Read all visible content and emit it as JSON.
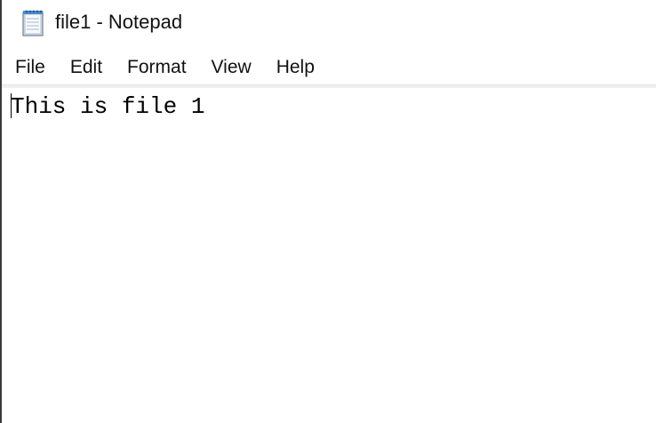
{
  "window": {
    "title": "file1 - Notepad",
    "icon": "notepad-icon"
  },
  "menu": {
    "items": [
      {
        "label": "File"
      },
      {
        "label": "Edit"
      },
      {
        "label": "Format"
      },
      {
        "label": "View"
      },
      {
        "label": "Help"
      }
    ]
  },
  "editor": {
    "content": "This is file 1"
  },
  "colors": {
    "background": "#ffffff",
    "text": "#000000",
    "menu_separator": "#f0f0f0"
  }
}
